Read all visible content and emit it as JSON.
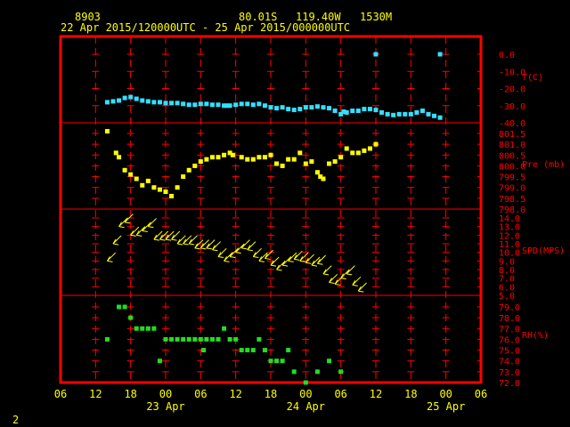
{
  "header": {
    "station": "8903",
    "lat": "80.01S",
    "lon": "119.40W",
    "elev": "1530M",
    "period": "22 Apr 2015/120000UTC - 25 Apr 2015/000000UTC"
  },
  "footer": {
    "page_number": "2"
  },
  "colors": {
    "frame": "#ff0000",
    "text": "#ffff00",
    "temp": "#33e0ff",
    "pressure": "#ffff00",
    "wind": "#ffff00",
    "rh": "#22dd22"
  },
  "chart_data": {
    "type": "scatter",
    "x_axis": {
      "unit": "hours from 22 Apr 2015 06 UTC",
      "range": [
        0,
        72
      ],
      "tick_labels": [
        "06",
        "12",
        "18",
        "00",
        "06",
        "12",
        "18",
        "00",
        "06",
        "12",
        "18",
        "00",
        "06"
      ],
      "date_labels": [
        {
          "label": "23 Apr",
          "x": 18
        },
        {
          "label": "24 Apr",
          "x": 42
        },
        {
          "label": "25 Apr",
          "x": 66
        }
      ]
    },
    "panels": [
      {
        "id": "temp",
        "label": "T(C)",
        "ylim": [
          -40,
          5
        ],
        "ticks": [
          "0.0",
          "-10.0",
          "-20.0",
          "-30.0",
          "-40.0"
        ],
        "tick_values": [
          0,
          -10,
          -20,
          -30,
          -40
        ],
        "points": [
          [
            8,
            -28
          ],
          [
            9,
            -27.5
          ],
          [
            10,
            -27
          ],
          [
            11,
            -25.5
          ],
          [
            12,
            -25
          ],
          [
            13,
            -26
          ],
          [
            14,
            -27
          ],
          [
            15,
            -27.5
          ],
          [
            16,
            -28
          ],
          [
            17,
            -28
          ],
          [
            18,
            -28.5
          ],
          [
            19,
            -28.5
          ],
          [
            20,
            -28.5
          ],
          [
            21,
            -29
          ],
          [
            22,
            -29.5
          ],
          [
            23,
            -29.5
          ],
          [
            24,
            -29
          ],
          [
            25,
            -29
          ],
          [
            26,
            -29.5
          ],
          [
            27,
            -29.5
          ],
          [
            28,
            -30
          ],
          [
            28.5,
            -30
          ],
          [
            29,
            -30
          ],
          [
            30,
            -29.5
          ],
          [
            31,
            -29
          ],
          [
            32,
            -29
          ],
          [
            33,
            -29.5
          ],
          [
            34,
            -29
          ],
          [
            35,
            -30
          ],
          [
            36,
            -31
          ],
          [
            37,
            -31.5
          ],
          [
            38,
            -31
          ],
          [
            39,
            -32
          ],
          [
            40,
            -32.5
          ],
          [
            41,
            -32
          ],
          [
            42,
            -31
          ],
          [
            43,
            -31
          ],
          [
            44,
            -30.5
          ],
          [
            45,
            -31
          ],
          [
            46,
            -31.5
          ],
          [
            47,
            -33
          ],
          [
            48,
            -35
          ],
          [
            48.5,
            -33.5
          ],
          [
            49,
            -34
          ],
          [
            50,
            -33
          ],
          [
            51,
            -33
          ],
          [
            52,
            -32
          ],
          [
            53,
            -32
          ],
          [
            54,
            -32.5
          ],
          [
            55,
            -34
          ],
          [
            56,
            -35
          ],
          [
            57,
            -35.5
          ],
          [
            58,
            -35
          ],
          [
            59,
            -35
          ],
          [
            60,
            -35
          ],
          [
            61,
            -34
          ],
          [
            62,
            -33
          ],
          [
            63,
            -35
          ],
          [
            64,
            -36
          ],
          [
            65,
            -37
          ],
          [
            54,
            0
          ],
          [
            65,
            0
          ]
        ]
      },
      {
        "id": "pressure",
        "label": "Pre (mb)",
        "ylim": [
          798,
          802
        ],
        "ticks": [
          "801.5",
          "801.0",
          "800.5",
          "800.0",
          "799.5",
          "799.0",
          "798.5",
          "798.0"
        ],
        "tick_values": [
          801.5,
          801.0,
          800.5,
          800.0,
          799.5,
          799.0,
          798.5,
          798.0
        ],
        "points": [
          [
            8,
            801.6
          ],
          [
            9.5,
            800.6
          ],
          [
            10,
            800.4
          ],
          [
            11,
            799.8
          ],
          [
            12,
            799.6
          ],
          [
            13,
            799.4
          ],
          [
            14,
            799.1
          ],
          [
            15,
            799.3
          ],
          [
            16,
            799.0
          ],
          [
            17,
            798.9
          ],
          [
            18,
            798.8
          ],
          [
            19,
            798.6
          ],
          [
            20,
            799.0
          ],
          [
            21,
            799.5
          ],
          [
            22,
            799.8
          ],
          [
            23,
            800.0
          ],
          [
            24,
            800.2
          ],
          [
            25,
            800.3
          ],
          [
            26,
            800.4
          ],
          [
            27,
            800.4
          ],
          [
            28,
            800.5
          ],
          [
            29,
            800.6
          ],
          [
            29.5,
            800.5
          ],
          [
            31,
            800.4
          ],
          [
            32,
            800.3
          ],
          [
            33,
            800.3
          ],
          [
            34,
            800.4
          ],
          [
            35,
            800.4
          ],
          [
            36,
            800.5
          ],
          [
            37,
            800.1
          ],
          [
            38,
            800.0
          ],
          [
            39,
            800.3
          ],
          [
            40,
            800.3
          ],
          [
            41,
            800.6
          ],
          [
            42,
            800.1
          ],
          [
            43,
            800.2
          ],
          [
            44,
            799.7
          ],
          [
            44.5,
            799.5
          ],
          [
            45,
            799.4
          ],
          [
            46,
            800.1
          ],
          [
            47,
            800.2
          ],
          [
            48,
            800.4
          ],
          [
            49,
            800.8
          ],
          [
            50,
            800.6
          ],
          [
            51,
            800.6
          ],
          [
            52,
            800.7
          ],
          [
            53,
            800.8
          ],
          [
            54,
            801.0
          ]
        ]
      },
      {
        "id": "wind",
        "label": "SPD(MPS)",
        "ylim": [
          4.5,
          14.5
        ],
        "ticks": [
          "14.0",
          "13.0",
          "12.0",
          "11.0",
          "10.0",
          "9.0",
          "8.0",
          "7.0",
          "6.0",
          "5.0"
        ],
        "tick_values": [
          14,
          13,
          12,
          11,
          10,
          9,
          8,
          7,
          6,
          5
        ],
        "barb_dir_deg": 45,
        "points": [
          [
            8,
            9.0
          ],
          [
            9,
            11.0
          ],
          [
            10,
            13.0
          ],
          [
            11,
            13.5
          ],
          [
            12,
            12.0
          ],
          [
            13,
            12.0
          ],
          [
            14,
            12.5
          ],
          [
            15,
            13.0
          ],
          [
            16,
            11.5
          ],
          [
            17,
            11.5
          ],
          [
            18,
            11.5
          ],
          [
            19,
            11.5
          ],
          [
            20,
            11.0
          ],
          [
            21,
            11.0
          ],
          [
            22,
            11.0
          ],
          [
            23,
            10.5
          ],
          [
            24,
            10.5
          ],
          [
            25,
            10.5
          ],
          [
            26,
            10.3
          ],
          [
            27,
            9.5
          ],
          [
            28,
            9.0
          ],
          [
            29,
            9.5
          ],
          [
            30,
            10.0
          ],
          [
            31,
            10.5
          ],
          [
            32,
            10.3
          ],
          [
            33,
            9.5
          ],
          [
            34,
            9.0
          ],
          [
            35,
            9.3
          ],
          [
            36,
            8.5
          ],
          [
            37,
            8.0
          ],
          [
            38,
            8.5
          ],
          [
            39,
            9.0
          ],
          [
            40,
            9.2
          ],
          [
            41,
            9.0
          ],
          [
            42,
            8.8
          ],
          [
            43,
            8.5
          ],
          [
            44,
            8.7
          ],
          [
            45,
            7.5
          ],
          [
            46,
            6.5
          ],
          [
            47,
            6.3
          ],
          [
            48,
            7.0
          ],
          [
            49,
            7.5
          ],
          [
            50,
            6.2
          ],
          [
            51,
            5.5
          ]
        ]
      },
      {
        "id": "rh",
        "label": "RH(%)",
        "ylim": [
          72,
          79.5
        ],
        "ticks": [
          "79.0",
          "78.0",
          "77.0",
          "76.0",
          "75.0",
          "74.0",
          "73.0",
          "72.0"
        ],
        "tick_values": [
          79,
          78,
          77,
          76,
          75,
          74,
          73,
          72
        ],
        "points": [
          [
            8,
            76
          ],
          [
            10,
            79
          ],
          [
            11,
            79
          ],
          [
            12,
            78
          ],
          [
            13,
            77
          ],
          [
            14,
            77
          ],
          [
            15,
            77
          ],
          [
            16,
            77
          ],
          [
            17,
            74
          ],
          [
            18,
            76
          ],
          [
            19,
            76
          ],
          [
            20,
            76
          ],
          [
            21,
            76
          ],
          [
            22,
            76
          ],
          [
            23,
            76
          ],
          [
            24,
            76
          ],
          [
            24.5,
            75
          ],
          [
            25,
            76
          ],
          [
            26,
            76
          ],
          [
            27,
            76
          ],
          [
            28,
            77
          ],
          [
            29,
            76
          ],
          [
            30,
            76
          ],
          [
            31,
            75
          ],
          [
            32,
            75
          ],
          [
            33,
            75
          ],
          [
            34,
            76
          ],
          [
            35,
            75
          ],
          [
            36,
            74
          ],
          [
            37,
            74
          ],
          [
            38,
            74
          ],
          [
            39,
            75
          ],
          [
            40,
            73
          ],
          [
            42,
            72
          ],
          [
            44,
            73
          ],
          [
            46,
            74
          ],
          [
            48,
            73
          ]
        ]
      }
    ]
  }
}
